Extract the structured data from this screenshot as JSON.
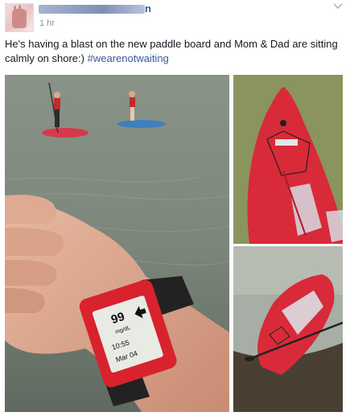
{
  "post": {
    "author_name_tail": "n",
    "timestamp": "1 hr",
    "text": "He's having a blast on the new paddle board and Mom & Dad are sitting calmly on shore:)",
    "hashtag": "#wearenotwaiting"
  },
  "watch": {
    "number": "99",
    "unit": "mg/dL",
    "date": "Mar 04",
    "time": "10:55"
  },
  "photos": [
    {
      "name": "paddle-board-lake-watch-photo"
    },
    {
      "name": "red-paddle-board-on-grass-photo"
    },
    {
      "name": "red-paddle-board-on-shore-photo"
    }
  ],
  "colors": {
    "link": "#3b5998",
    "board_red": "#d92a3a",
    "watch_red": "#d8232f"
  }
}
